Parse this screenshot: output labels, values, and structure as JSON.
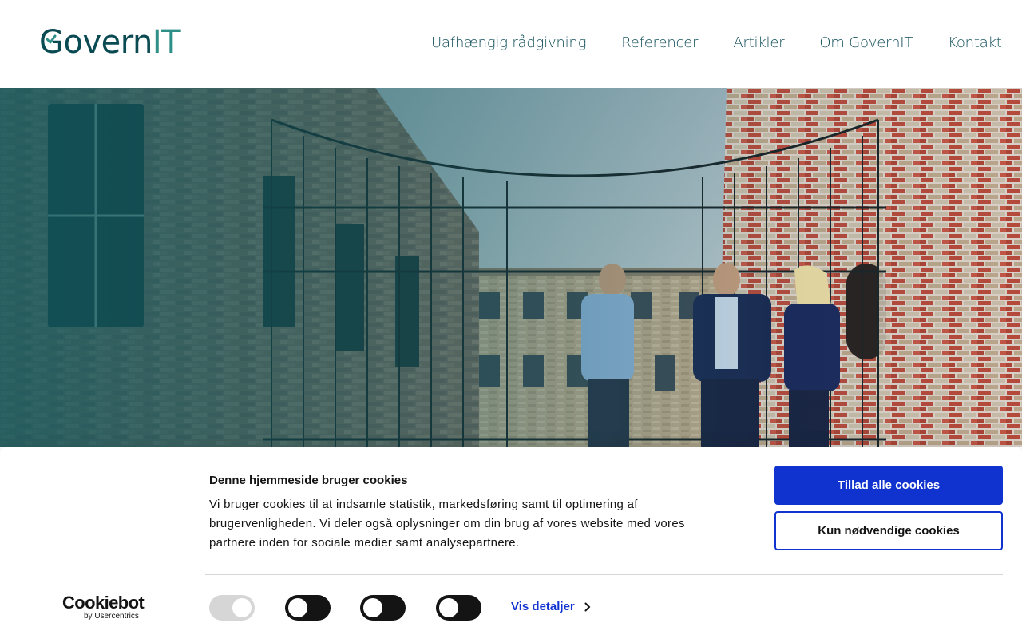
{
  "header": {
    "logo": {
      "part1": "Govern",
      "part2": "IT"
    },
    "nav": [
      {
        "label": "Uafhængig rådgivning"
      },
      {
        "label": "Referencer"
      },
      {
        "label": "Artikler"
      },
      {
        "label": "Om GovernIT"
      },
      {
        "label": "Kontakt"
      }
    ]
  },
  "cookie_banner": {
    "title": "Denne hjemmeside bruger cookies",
    "text": "Vi bruger cookies til at indsamle statistik, markedsføring samt til optimering af brugervenligheden. Vi deler også oplysninger om din brug af vores website med vores partnere inden for sociale medier samt analysepartnere.",
    "allow_all_label": "Tillad alle cookies",
    "necessary_only_label": "Kun nødvendige cookies",
    "details_label": "Vis detaljer",
    "brand": {
      "name": "Cookiebot",
      "sub": "by Usercentrics"
    },
    "toggles": [
      {
        "state": "on",
        "disabled": true
      },
      {
        "state": "off",
        "disabled": false
      },
      {
        "state": "off",
        "disabled": false
      },
      {
        "state": "off",
        "disabled": false
      }
    ]
  },
  "colors": {
    "brand_dark": "#0a4a52",
    "brand_teal": "#2e8f86",
    "button_blue": "#1032cf"
  }
}
